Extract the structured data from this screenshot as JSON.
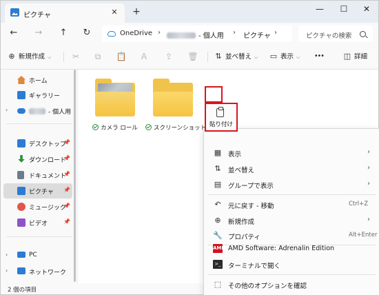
{
  "window": {
    "tab_title": "ピクチャ",
    "tab_close_icon": "✕",
    "new_tab_icon": "+",
    "minimize_icon": "—",
    "maximize_icon": "☐",
    "close_icon": "✕"
  },
  "navbar": {
    "back_icon": "←",
    "forward_icon": "→",
    "up_icon": "↑",
    "refresh_icon": "↻",
    "breadcrumb": {
      "onedrive": "OneDrive",
      "personal_suffix": "- 個人用",
      "current": "ピクチャ",
      "separator": "›"
    },
    "search_placeholder": "ピクチャの検索"
  },
  "commandbar": {
    "new_label": "新規作成",
    "new_icon": "⊕",
    "sort_label": "並べ替え",
    "sort_icon": "⇅",
    "view_label": "表示",
    "view_icon": "▭",
    "more_label": "•••",
    "details_label": "詳細",
    "details_icon": "◫",
    "cut_icon": "✂",
    "copy_icon": "⧉",
    "paste_icon": "📋",
    "rename_icon": "Ａ",
    "share_icon": "⇪",
    "delete_icon": "🗑",
    "caret": "⌵"
  },
  "sidebar": {
    "items": [
      {
        "label": "ホーム",
        "icon": "home-icon",
        "color": "#e0883a"
      },
      {
        "label": "ギャラリー",
        "icon": "gallery-icon",
        "color": "#2b7cd3"
      },
      {
        "label": "- 個人用",
        "icon": "onedrive-icon",
        "color": "#2b7cd3"
      },
      {
        "label": "デスクトップ",
        "icon": "desktop-icon",
        "color": "#2b7cd3"
      },
      {
        "label": "ダウンロード",
        "icon": "download-icon",
        "color": "#2c8d3f"
      },
      {
        "label": "ドキュメント",
        "icon": "document-icon",
        "color": "#6d7c8c"
      },
      {
        "label": "ピクチャ",
        "icon": "pictures-icon",
        "color": "#2b7cd3"
      },
      {
        "label": "ミュージック",
        "icon": "music-icon",
        "color": "#e0564a"
      },
      {
        "label": "ビデオ",
        "icon": "video-icon",
        "color": "#8e52c9"
      },
      {
        "label": "PC",
        "icon": "pc-icon",
        "color": "#2b7cd3"
      },
      {
        "label": "ネットワーク",
        "icon": "network-icon",
        "color": "#2b7cd3"
      }
    ],
    "pin_icon": "📌",
    "expand_icon": "›"
  },
  "content": {
    "folders": [
      {
        "label": "カメラ ロール"
      },
      {
        "label": "スクリーンショット"
      }
    ]
  },
  "context_menu": {
    "paste_label": "貼り付け",
    "items": [
      {
        "label": "表示",
        "icon": "▦",
        "arrow": "›"
      },
      {
        "label": "並べ替え",
        "icon": "⇅",
        "arrow": "›"
      },
      {
        "label": "グループで表示",
        "icon": "▤",
        "arrow": "›"
      },
      {
        "label": "元に戻す - 移動",
        "icon": "↶",
        "shortcut": "Ctrl+Z"
      },
      {
        "label": "新規作成",
        "icon": "⊕",
        "arrow": "›"
      },
      {
        "label": "プロパティ",
        "icon": "🔧",
        "shortcut": "Alt+Enter"
      },
      {
        "label": "AMD Software: Adrenalin Edition",
        "icon": "AMD"
      },
      {
        "label": "ターミナルで開く",
        "icon": ">_"
      },
      {
        "label": "その他のオプションを確認",
        "icon": "⬚"
      }
    ]
  },
  "status": {
    "text": "2 個の項目"
  },
  "colors": {
    "accent": "#2b7cd3",
    "highlight": "#d9141c",
    "folder": "#f5c342"
  }
}
